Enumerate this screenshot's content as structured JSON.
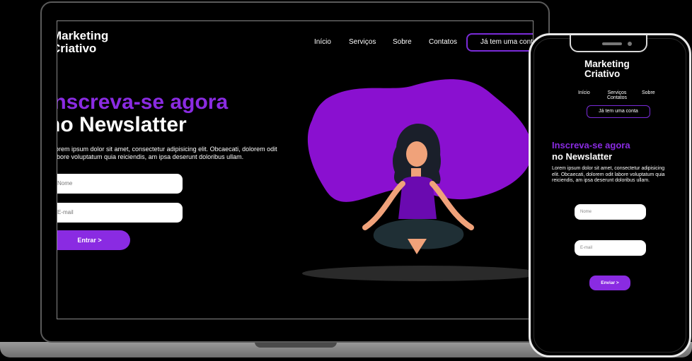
{
  "laptop": {
    "brand": {
      "line1": "Marketing",
      "line2": "Criativo"
    },
    "nav": [
      "Início",
      "Serviços",
      "Sobre",
      "Contatos"
    ],
    "cta_label": "Já tem uma conta",
    "headline_line1": "Inscreva-se agora",
    "headline_line2": "no Newslatter",
    "paragraph": "Lorem ipsum dolor sit amet, consectetur adipisicing elit. Obcaecati, dolorem odit labore voluptatum quia reiciendis, am ipsa deserunt doloribus ullam.",
    "input_name_placeholder": "Nome",
    "input_email_placeholder": "E-mail",
    "submit_label": "Entrar >"
  },
  "phone": {
    "brand": {
      "line1": "Marketing",
      "line2": "Criativo"
    },
    "nav": [
      "Início",
      "Serviços Contatos",
      "Sobre"
    ],
    "cta_label": "Já tem uma conta",
    "headline_line1": "Inscreva-se agora",
    "headline_line2": "no Newslatter",
    "paragraph": "Lorem ipsum dolor sit amet, consectetur adipisicing elit. Obcaecati, dolorem odit labore voluptatum quia reiciendis, am ipsa deserunt doloribus ullam.",
    "input_name_placeholder": "Nome",
    "input_email_placeholder": "E-mail",
    "submit_label": "Enviar >"
  },
  "colors": {
    "accent": "#8a2be2",
    "background": "#000000",
    "skin": "#f0a27a",
    "pants": "#1f2f35"
  },
  "illustration": {
    "icon": "meditating-woman-illustration"
  }
}
